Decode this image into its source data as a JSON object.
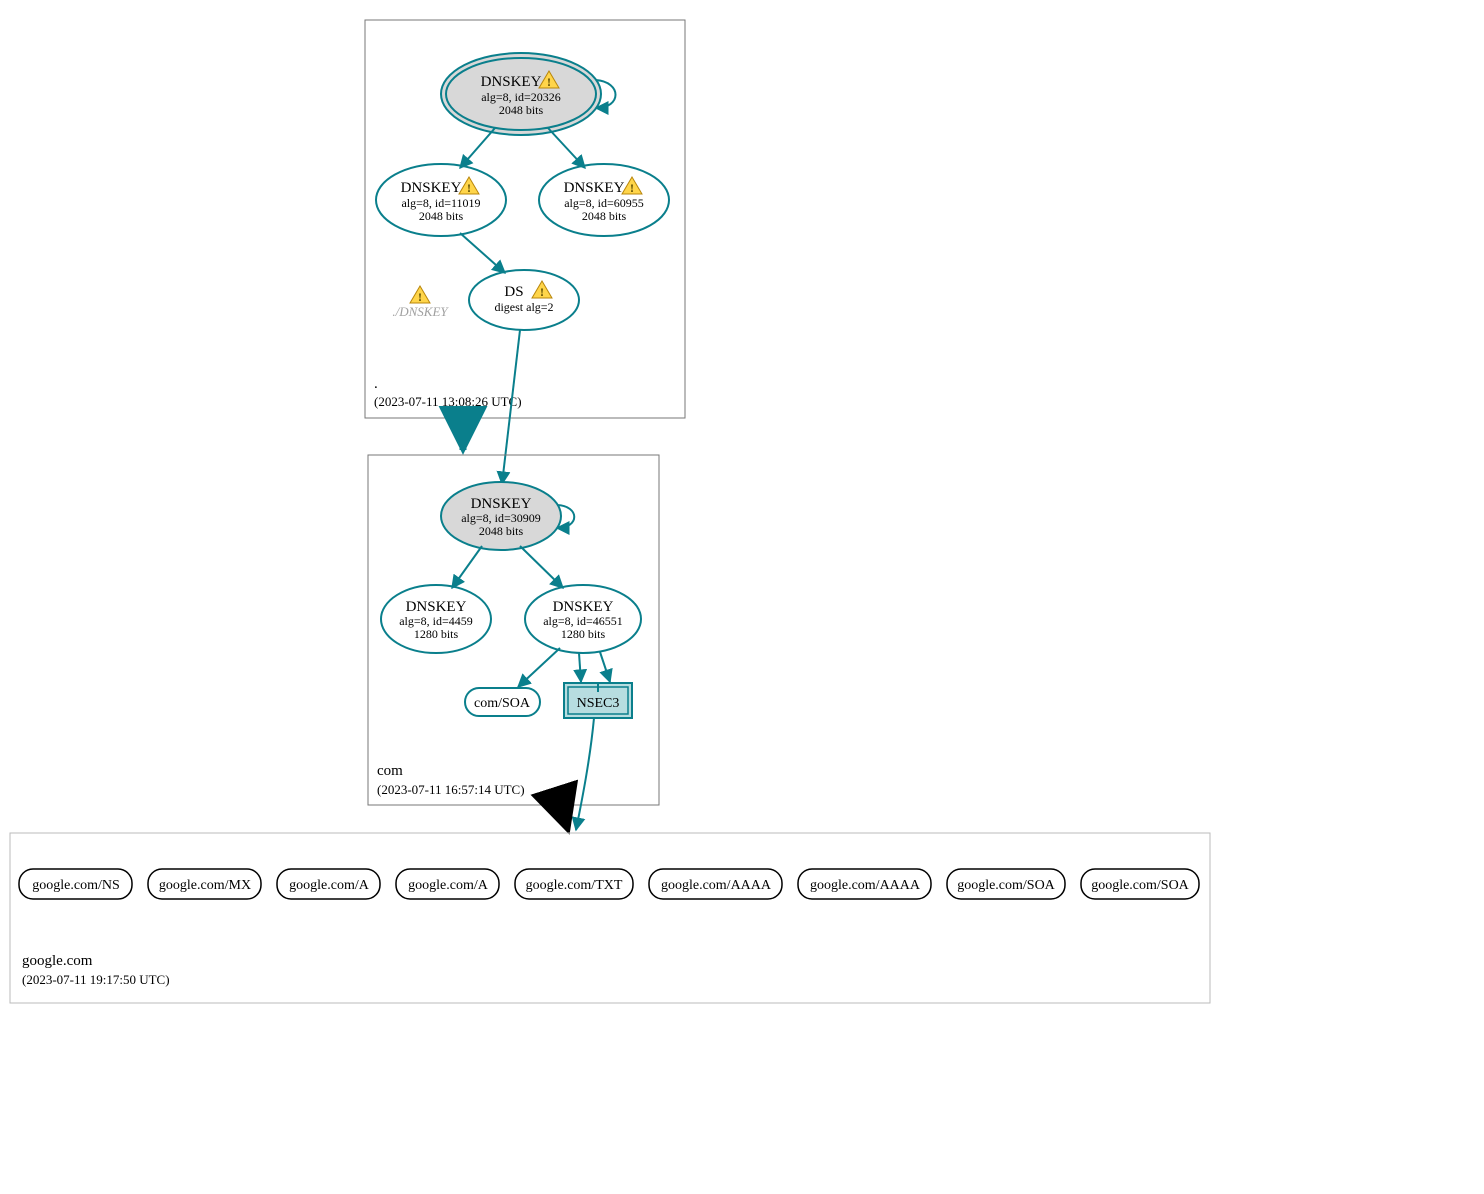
{
  "colors": {
    "stroke": "#0a7f8c",
    "fillGrey": "#d8d8d8",
    "fillNSEC": "#b7dde0",
    "black": "#000000",
    "greyText": "#a0a0a0"
  },
  "warnings": {
    "glyph": "⚠"
  },
  "zones": {
    "root": {
      "label": ".",
      "timestamp": "(2023-07-11 13:08:26 UTC)"
    },
    "com": {
      "label": "com",
      "timestamp": "(2023-07-11 16:57:14 UTC)"
    },
    "google": {
      "label": "google.com",
      "timestamp": "(2023-07-11 19:17:50 UTC)"
    }
  },
  "nodes": {
    "rootKSK": {
      "title": "DNSKEY",
      "line2": "alg=8, id=20326",
      "line3": "2048 bits",
      "warn": true
    },
    "rootZSK1": {
      "title": "DNSKEY",
      "line2": "alg=8, id=11019",
      "line3": "2048 bits",
      "warn": true
    },
    "rootZSK2": {
      "title": "DNSKEY",
      "line2": "alg=8, id=60955",
      "line3": "2048 bits",
      "warn": true
    },
    "rootDNSKEYghost": {
      "title": "./DNSKEY",
      "warn": true
    },
    "rootDS": {
      "title": "DS",
      "line2": "digest alg=2",
      "warn": true
    },
    "comKSK": {
      "title": "DNSKEY",
      "line2": "alg=8, id=30909",
      "line3": "2048 bits",
      "warn": false
    },
    "comZSK1": {
      "title": "DNSKEY",
      "line2": "alg=8, id=4459",
      "line3": "1280 bits",
      "warn": false
    },
    "comZSK2": {
      "title": "DNSKEY",
      "line2": "alg=8, id=46551",
      "line3": "1280 bits",
      "warn": false
    },
    "comSOA": {
      "title": "com/SOA"
    },
    "comNSEC3": {
      "title": "NSEC3"
    },
    "leaves": [
      {
        "title": "google.com/NS"
      },
      {
        "title": "google.com/MX"
      },
      {
        "title": "google.com/A"
      },
      {
        "title": "google.com/A"
      },
      {
        "title": "google.com/TXT"
      },
      {
        "title": "google.com/AAAA"
      },
      {
        "title": "google.com/AAAA"
      },
      {
        "title": "google.com/SOA"
      },
      {
        "title": "google.com/SOA"
      }
    ]
  }
}
